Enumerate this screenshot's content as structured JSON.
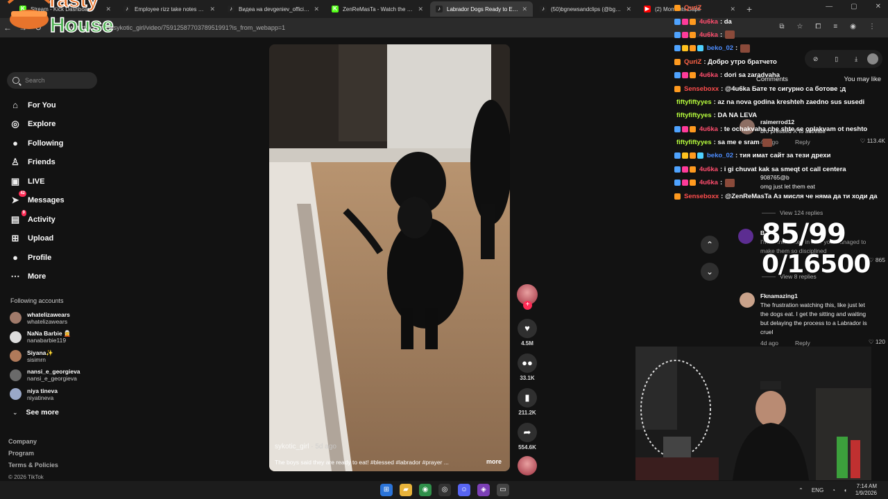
{
  "browser": {
    "tabs": [
      {
        "label": "Stream - Kick Dashboard",
        "fav": "K",
        "fav_color": "#53fc18",
        "active": false
      },
      {
        "label": "Employee rizz take notes 📄 #e",
        "fav": "♪",
        "fav_color": "#222222",
        "active": false
      },
      {
        "label": "Видеа на devgeniev_official (@",
        "fav": "♪",
        "fav_color": "#222222",
        "active": false
      },
      {
        "label": "ZenReMasTa - Watch the VOD",
        "fav": "K",
        "fav_color": "#53fc18",
        "active": false
      },
      {
        "label": "Labrador Dogs Ready to Eat: A",
        "fav": "♪",
        "fav_color": "#222222",
        "active": true
      },
      {
        "label": "(50)bgnewsandclips (@bgnew",
        "fav": "♪",
        "fav_color": "#222222",
        "active": false
      },
      {
        "label": "(2) Moments Capti",
        "fav": "▶",
        "fav_color": "#ff0000",
        "active": false
      }
    ],
    "new_tab": "+",
    "url_domain": "www.tiktok.com",
    "url_path": "/@sykotic_girl/video/7591258770378951991?is_from_webapp=1"
  },
  "logo": {
    "line1": "Tasty",
    "line2": "House"
  },
  "sidebar": {
    "search_placeholder": "Search",
    "nav": [
      {
        "label": "For You",
        "icon": "⌂",
        "name": "home-icon"
      },
      {
        "label": "Explore",
        "icon": "◎",
        "name": "compass-icon"
      },
      {
        "label": "Following",
        "icon": "●",
        "name": "following-icon"
      },
      {
        "label": "Friends",
        "icon": "♙",
        "name": "friends-icon"
      },
      {
        "label": "LIVE",
        "icon": "▣",
        "name": "live-icon"
      },
      {
        "label": "Messages",
        "icon": "➤",
        "name": "messages-icon",
        "badge": "42"
      },
      {
        "label": "Activity",
        "icon": "▤",
        "name": "activity-icon",
        "badge": "9"
      },
      {
        "label": "Upload",
        "icon": "⊞",
        "name": "upload-icon"
      },
      {
        "label": "Profile",
        "icon": "●",
        "name": "profile-icon"
      },
      {
        "label": "More",
        "icon": "⋯",
        "name": "more-icon"
      }
    ],
    "following_title": "Following accounts",
    "following": [
      {
        "name": "whatelizawears",
        "user": "whatelizawears"
      },
      {
        "name": "NaNa Barbie 🧝",
        "user": "nanabarbie119"
      },
      {
        "name": "Siyana✨",
        "user": "sisimrn"
      },
      {
        "name": "nansi_e_georgieva",
        "user": "nansi_e_georgieva"
      },
      {
        "name": "niya tineva",
        "user": "niyatineva"
      }
    ],
    "see_more": "See more",
    "footer": [
      "Company",
      "Program",
      "Terms & Policies"
    ],
    "copyright": "© 2026 TikTok"
  },
  "video": {
    "author": "sykotic_girl",
    "date": " · 5d ago",
    "caption": "The boys said they are ready to eat! #blessed #labrador #prayer ...",
    "more": "more"
  },
  "actions": {
    "likes": "4.5M",
    "comments": "33.1K",
    "saves": "211.2K",
    "shares": "554.6K"
  },
  "comments_panel": {
    "tab_comments": "Comments",
    "tab_you_may_like": "You may like",
    "comments": [
      {
        "user": "raimerrod12",
        "text": "bro pressed X to activate",
        "date": "4d ago",
        "reply": "Reply",
        "likes": "113.4K"
      },
      {
        "user": "908765@b",
        "text": "omg just let them eat",
        "date": "",
        "reply": "",
        "likes": ""
      },
      {
        "user": "B",
        "text": "I'm so interested in how you managed to make them so disciplined",
        "date": "",
        "reply": "",
        "likes": "865"
      },
      {
        "user": "Fknamazing1",
        "text": "The frustration watching this, like just let the dogs eat. I get the sitting and waiting but delaying the process to a Labrador is cruel",
        "date": "4d ago",
        "reply": "Reply",
        "likes": "120"
      }
    ],
    "view_replies_1": "View 124 replies",
    "view_replies_2": "View 8 replies"
  },
  "overlay": {
    "counter_1": "85/99",
    "counter_2": "0/16500"
  },
  "chat": [
    {
      "user": "QuriZ",
      "color": "#ff6347",
      "msg": "",
      "badges": [
        "#ff9a1f"
      ]
    },
    {
      "user": "4u6ka",
      "color": "#ff4d6d",
      "msg": ": da",
      "badges": [
        "#4fa3ff",
        "#ff3b9a",
        "#ff9a1f"
      ]
    },
    {
      "user": "4u6ka",
      "color": "#ff4d6d",
      "msg": ":",
      "badges": [
        "#4fa3ff",
        "#ff3b9a",
        "#ff9a1f"
      ],
      "emote": true
    },
    {
      "user": "beko_02",
      "color": "#4d8dff",
      "msg": ":",
      "badges": [
        "#4fa3ff",
        "#ffc21f",
        "#ff9a1f",
        "#4fd1ff"
      ],
      "emote": true
    },
    {
      "user": "QuriZ",
      "color": "#ff6347",
      "msg": ": Добро утро братчето",
      "badges": [
        "#ff9a1f"
      ]
    },
    {
      "user": "4u6ka",
      "color": "#ff4d6d",
      "msg": ": dori sa zaradvaha",
      "badges": [
        "#4fa3ff",
        "#ff3b9a",
        "#ff9a1f"
      ]
    },
    {
      "user": "Senseboxx",
      "color": "#ff4d4d",
      "msg": ": @4u6ka Бате те сигурно са ботове ;д",
      "badges": [
        "#ff9a1f"
      ]
    },
    {
      "user": "fiftyfiftyyes",
      "color": "#b9ff3d",
      "msg": ": az na nova godina kreshteh zaedno sus susedi",
      "badges": []
    },
    {
      "user": "fiftyfiftyyes",
      "color": "#b9ff3d",
      "msg": ": DA NA LEVA",
      "badges": []
    },
    {
      "user": "4u6ka",
      "color": "#ff4d6d",
      "msg": ": te ochakvaha che shte se oplakvam ot neshto",
      "badges": [
        "#4fa3ff",
        "#ff3b9a",
        "#ff9a1f"
      ]
    },
    {
      "user": "fiftyfiftyyes",
      "color": "#b9ff3d",
      "msg": ": sa me e sram",
      "badges": [],
      "emote": true
    },
    {
      "user": "beko_02",
      "color": "#4d8dff",
      "msg": ": тия имат сайт за тези дрехи",
      "badges": [
        "#4fa3ff",
        "#ffc21f",
        "#ff9a1f",
        "#4fd1ff"
      ]
    },
    {
      "user": "4u6ka",
      "color": "#ff4d6d",
      "msg": ": i gi chuvat kak sa smeqt ot call centera",
      "badges": [
        "#4fa3ff",
        "#ff3b9a",
        "#ff9a1f"
      ]
    },
    {
      "user": "4u6ka",
      "color": "#ff4d6d",
      "msg": ":",
      "badges": [
        "#4fa3ff",
        "#ff3b9a",
        "#ff9a1f"
      ],
      "emote": true
    },
    {
      "user": "Senseboxx",
      "color": "#ff4d4d",
      "msg": ": @ZenReMasTa Аз мисля че няма да ти ходи да",
      "badges": [
        "#ff9a1f"
      ]
    }
  ],
  "taskbar": {
    "lang": "ENG",
    "time": "7:14 AM",
    "date": "1/9/2026"
  }
}
